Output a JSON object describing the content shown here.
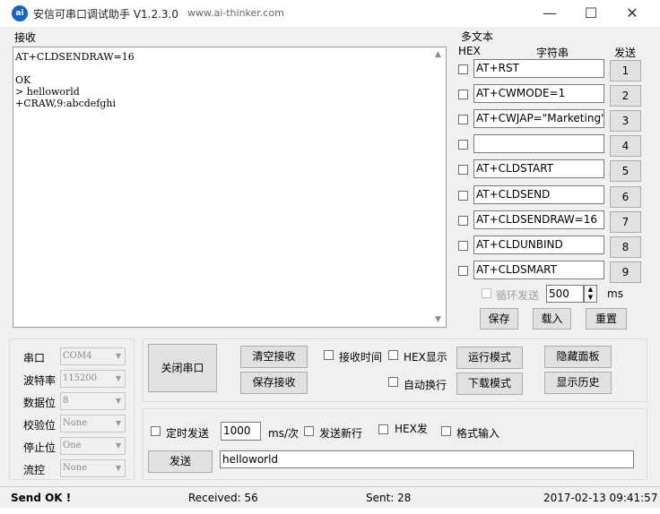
{
  "window": {
    "icon_text": "ai",
    "title": "安信可串口调试助手 V1.2.3.0",
    "url": "www.ai-thinker.com",
    "minimize": "—",
    "maximize": "☐",
    "close": "✕"
  },
  "receive": {
    "label": "接收",
    "text": "AT+CLDSENDRAW=16\n\nOK\n> helloworld\n+CRAW,9:abcdefghi"
  },
  "multi": {
    "title": "多文本",
    "hex_header": "HEX",
    "string_header": "字符串",
    "send_header": "发送",
    "rows": [
      {
        "text": "AT+RST",
        "button": "1"
      },
      {
        "text": "AT+CWMODE=1",
        "button": "2"
      },
      {
        "text": "AT+CWJAP=\"Marketing\",\"z",
        "button": "3"
      },
      {
        "text": "",
        "button": "4"
      },
      {
        "text": "AT+CLDSTART",
        "button": "5"
      },
      {
        "text": "AT+CLDSEND",
        "button": "6"
      },
      {
        "text": "AT+CLDSENDRAW=16",
        "button": "7"
      },
      {
        "text": "AT+CLDUNBIND",
        "button": "8"
      },
      {
        "text": "AT+CLDSMART",
        "button": "9"
      }
    ],
    "loop_label": "循环发送",
    "loop_ms": "500",
    "loop_unit": "ms",
    "save": "保存",
    "load": "载入",
    "reset": "重置"
  },
  "port": {
    "port_label": "串口",
    "port_value": "COM4",
    "baud_label": "波特率",
    "baud_value": "115200",
    "databits_label": "数据位",
    "databits_value": "8",
    "parity_label": "校验位",
    "parity_value": "None",
    "stopbits_label": "停止位",
    "stopbits_value": "One",
    "flow_label": "流控",
    "flow_value": "None"
  },
  "controls": {
    "close_port": "关闭串口",
    "clear_recv": "清空接收",
    "save_recv": "保存接收",
    "recv_time": "接收时间",
    "hex_display": "HEX显示",
    "auto_wrap": "自动换行",
    "run_mode": "运行模式",
    "download_mode": "下载模式",
    "hide_panel": "隐藏面板",
    "show_history": "显示历史"
  },
  "send": {
    "timed_send": "定时发送",
    "interval_value": "1000",
    "interval_unit": "ms/次",
    "send_newline": "发送新行",
    "hex_send": "HEX发",
    "format_input": "格式输入",
    "send_button": "发送",
    "send_text": "helloworld"
  },
  "status": {
    "result": "Send OK !",
    "received": "Received: 56",
    "sent": "Sent: 28",
    "datetime": "2017-02-13 09:41:57"
  }
}
